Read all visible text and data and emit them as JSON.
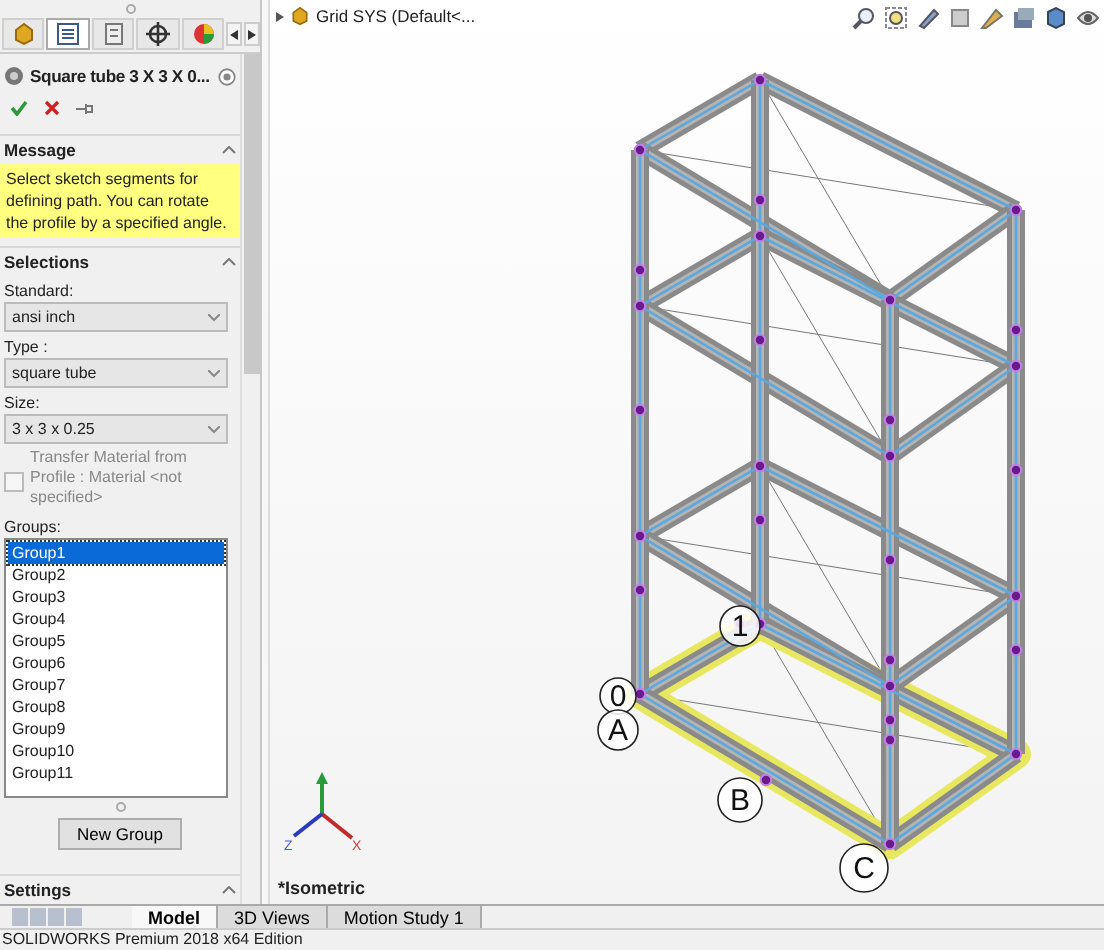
{
  "panel": {
    "tabs": [
      {
        "kind": "part",
        "selected": false
      },
      {
        "kind": "property",
        "selected": true
      },
      {
        "kind": "config",
        "selected": false
      },
      {
        "kind": "target",
        "selected": false
      },
      {
        "kind": "appearance",
        "selected": false
      }
    ],
    "title": "Square tube 3 X 3 X 0...",
    "message": {
      "title": "Message",
      "text": "Select sketch segments for defining path. You can rotate the profile by a specified angle."
    },
    "selections": {
      "title": "Selections",
      "fields": [
        {
          "label": "Standard:",
          "value": "ansi inch"
        },
        {
          "label": "Type :",
          "value": "square tube"
        },
        {
          "label": "Size:",
          "value": "3 x 3 x 0.25"
        }
      ],
      "transfer": {
        "label": "Transfer Material from Profile : Material <not specified>",
        "checked": false,
        "disabled": true
      },
      "groups_label": "Groups:",
      "groups": [
        {
          "label": "Group1",
          "selected": true
        },
        {
          "label": "Group2",
          "selected": false
        },
        {
          "label": "Group3",
          "selected": false
        },
        {
          "label": "Group4",
          "selected": false
        },
        {
          "label": "Group5",
          "selected": false
        },
        {
          "label": "Group6",
          "selected": false
        },
        {
          "label": "Group7",
          "selected": false
        },
        {
          "label": "Group8",
          "selected": false
        },
        {
          "label": "Group9",
          "selected": false
        },
        {
          "label": "Group10",
          "selected": false
        },
        {
          "label": "Group11",
          "selected": false
        }
      ],
      "button": "New Group"
    },
    "settings": {
      "title": "Settings"
    }
  },
  "viewport": {
    "tree_item": "Grid SYS  (Default<...",
    "view_name": "*Isometric",
    "axes": [
      "Z",
      "X"
    ],
    "callouts": [
      "1",
      "0",
      "A",
      "B",
      "C"
    ]
  },
  "bottom_tabs": [
    {
      "label": "Model",
      "selected": true
    },
    {
      "label": "3D Views",
      "selected": false
    },
    {
      "label": "Motion Study 1",
      "selected": false
    }
  ],
  "status_bar": "SOLIDWORKS Premium 2018 x64 Edition"
}
